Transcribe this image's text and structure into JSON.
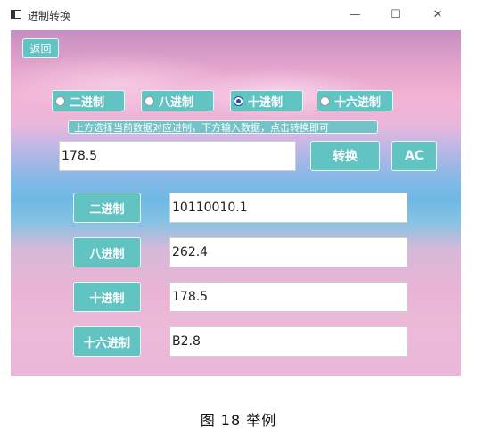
{
  "window": {
    "title": "进制转换",
    "minimize_glyph": "—",
    "maximize_glyph": "☐",
    "close_glyph": "✕"
  },
  "back_button": "返回",
  "radios": [
    {
      "label": "二进制",
      "checked": false
    },
    {
      "label": "八进制",
      "checked": false
    },
    {
      "label": "十进制",
      "checked": true
    },
    {
      "label": "十六进制",
      "checked": false
    }
  ],
  "hint": "上方选择当前数据对应进制，下方输入数据，点击转换即可",
  "input": {
    "value": "178.5"
  },
  "convert_button": "转换",
  "ac_button": "AC",
  "outputs": [
    {
      "label": "二进制",
      "value": "10110010.1"
    },
    {
      "label": "八进制",
      "value": "262.4"
    },
    {
      "label": "十进制",
      "value": "178.5"
    },
    {
      "label": "十六进制",
      "value": "B2.8"
    }
  ],
  "caption": "图  18 举例"
}
